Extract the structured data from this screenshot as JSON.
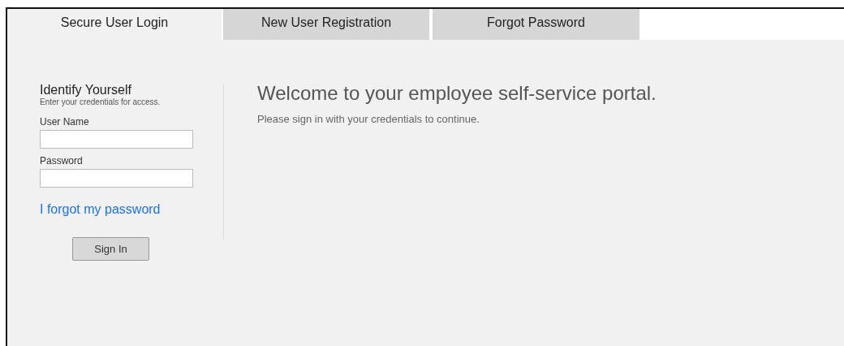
{
  "tabs": [
    {
      "label": "Secure User Login",
      "selected": true
    },
    {
      "label": "New User Registration",
      "selected": false
    },
    {
      "label": "Forgot Password",
      "selected": false
    }
  ],
  "login": {
    "title": "Identify Yourself",
    "subtitle": "Enter your credentials for access.",
    "fields": [
      {
        "label": "User Name"
      },
      {
        "label": "Password"
      }
    ],
    "forgot_link": "I forgot my password",
    "button": "Sign In"
  },
  "welcome": {
    "heading": "Welcome to your employee self-service portal.",
    "text": "Please sign in with your credentials to continue."
  }
}
